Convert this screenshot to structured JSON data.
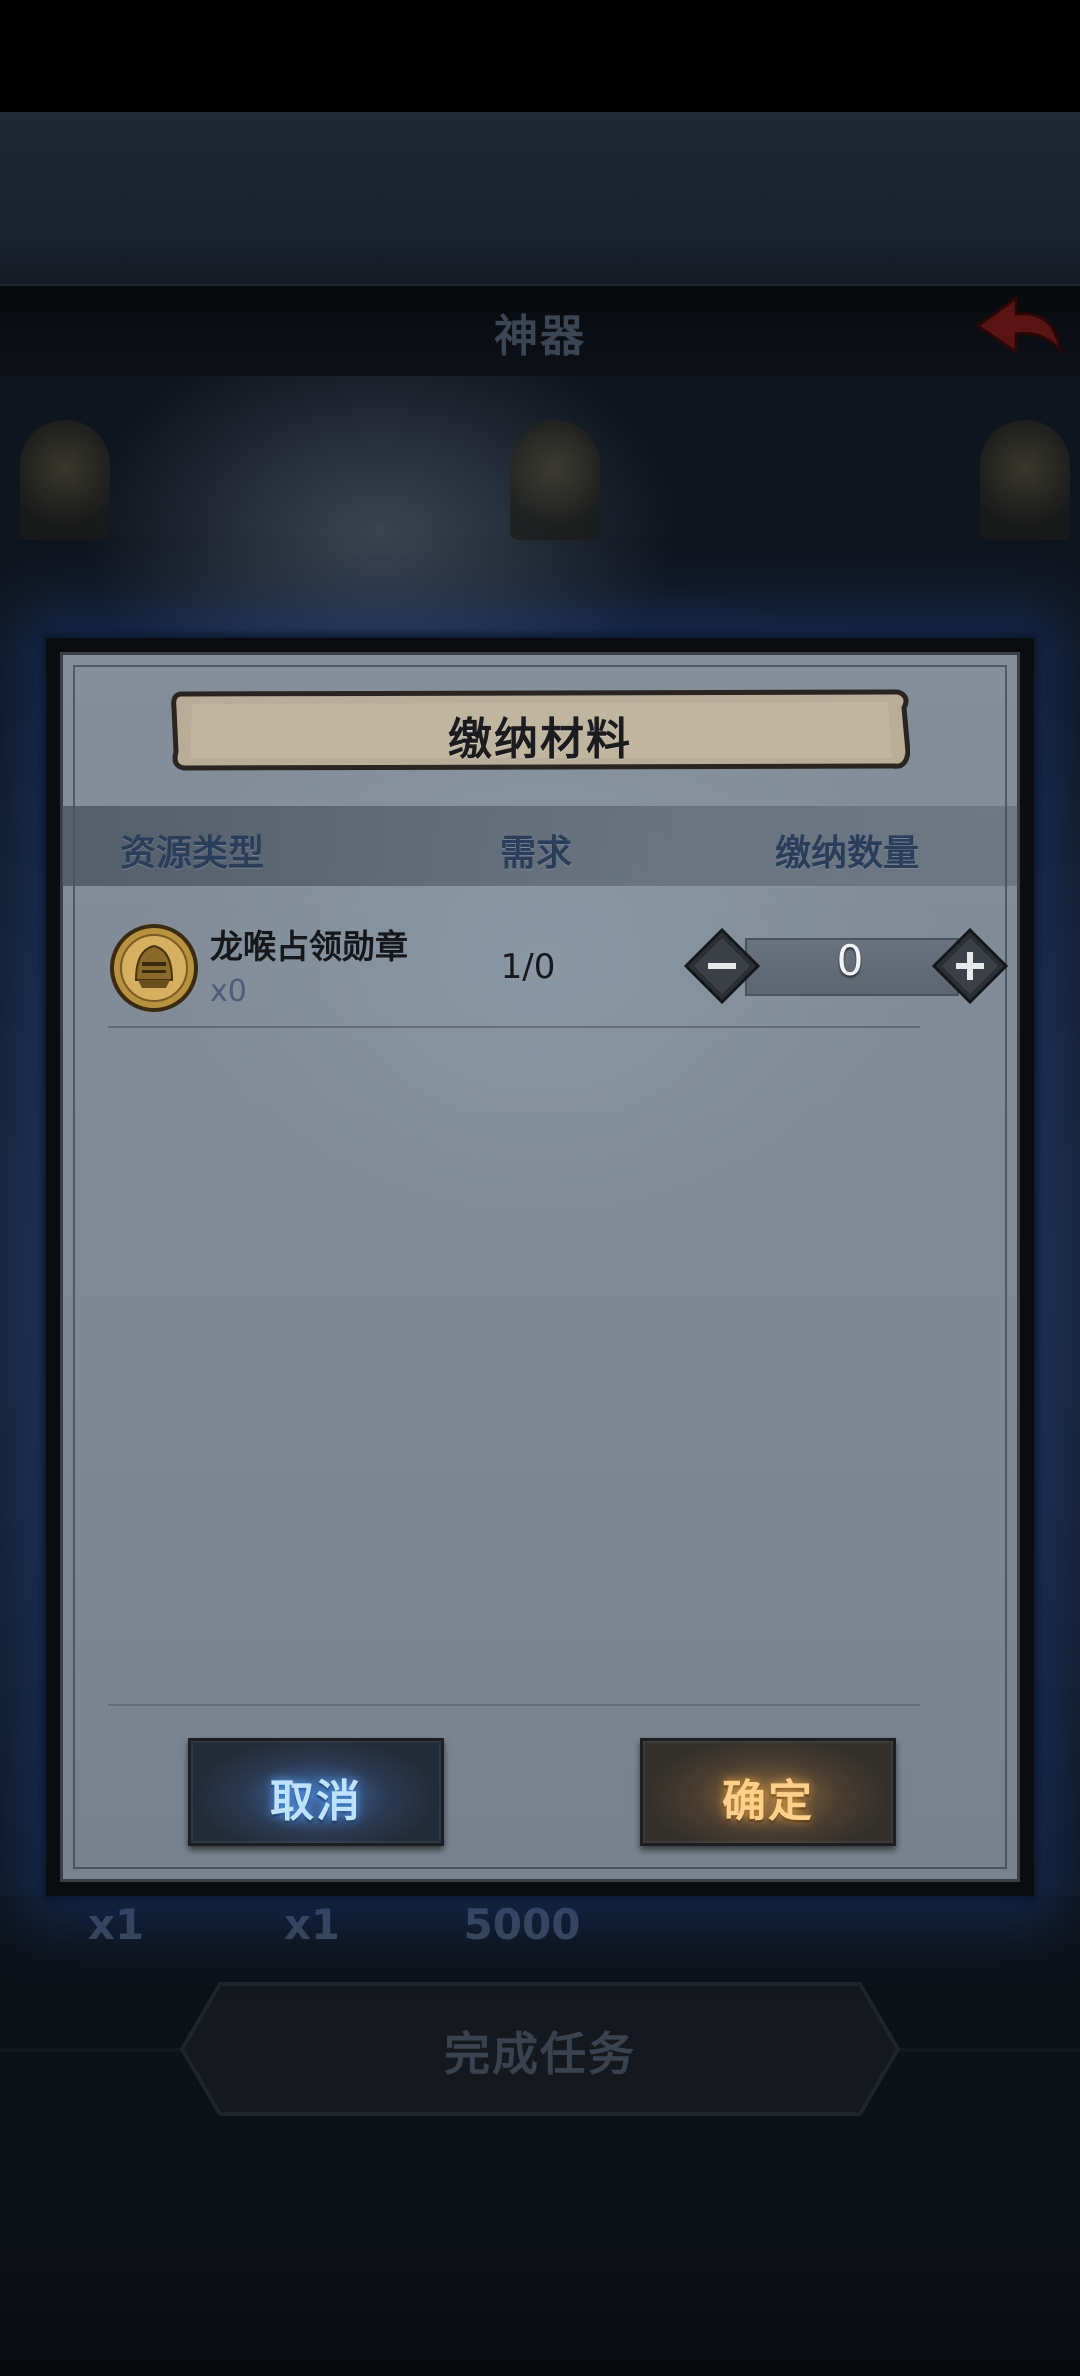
{
  "background": {
    "title": "神器",
    "rewards": [
      "x1",
      "x1",
      "5000"
    ],
    "complete_button": "完成任务"
  },
  "dialog": {
    "title": "缴纳材料",
    "columns": {
      "resource_type": "资源类型",
      "demand": "需求",
      "submit_amount": "缴纳数量"
    },
    "items": [
      {
        "name": "龙喉占领勋章",
        "owned": "x0",
        "demand": "1/0",
        "submit_value": "0",
        "icon": "helmet-medal-icon"
      }
    ],
    "cancel_label": "取消",
    "confirm_label": "确定"
  },
  "colors": {
    "accent_blue": "#5aa6ff",
    "accent_gold": "#e7a24a",
    "panel": "#848f9b"
  }
}
